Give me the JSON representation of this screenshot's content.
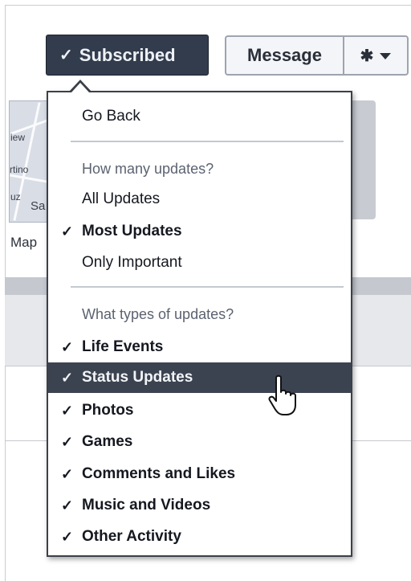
{
  "toolbar": {
    "subscribed_label": "Subscribed",
    "message_label": "Message",
    "gear_icon": "gear-icon"
  },
  "sidebar": {
    "map_label": "Map",
    "map_words": [
      "iew",
      "rtino",
      "Sa",
      "uz"
    ]
  },
  "menu": {
    "go_back": "Go Back",
    "how_many_header": "How many updates?",
    "all_updates": "All Updates",
    "most_updates": "Most Updates",
    "only_important": "Only Important",
    "types_header": "What types of updates?",
    "types": [
      {
        "label": "Life Events",
        "checked": true
      },
      {
        "label": "Status Updates",
        "checked": true,
        "highlighted": true
      },
      {
        "label": "Photos",
        "checked": true
      },
      {
        "label": "Games",
        "checked": true
      },
      {
        "label": "Comments and Likes",
        "checked": true
      },
      {
        "label": "Music and Videos",
        "checked": true
      },
      {
        "label": "Other Activity",
        "checked": true
      }
    ]
  },
  "colors": {
    "subscribed_bg": "#333c4c",
    "highlight_bg": "#3c4350"
  }
}
